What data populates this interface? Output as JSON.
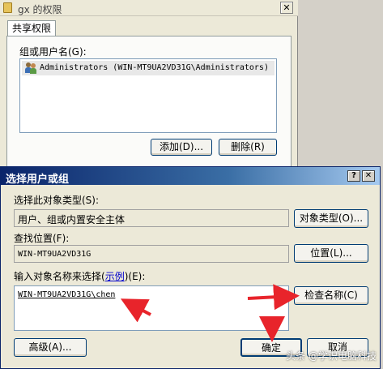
{
  "background_window": {
    "title": "gx 的权限",
    "close_label": "✕",
    "tab_label": "共享权限",
    "group_label": "组或用户名(G):",
    "list_items": [
      "Administrators (WIN-MT9UA2VD31G\\Administrators)"
    ],
    "add_button": "添加(D)...",
    "remove_button": "删除(R)"
  },
  "dialog": {
    "title": "选择用户或组",
    "help_label": "?",
    "close_label": "✕",
    "object_type_label": "选择此对象类型(S):",
    "object_type_value": "用户、组或内置安全主体",
    "object_type_button": "对象类型(O)...",
    "location_label": "查找位置(F):",
    "location_value": "WIN-MT9UA2VD31G",
    "location_button": "位置(L)...",
    "names_label_prefix": "输入对象名称来选择(",
    "names_label_link": "示例",
    "names_label_suffix": ")(E):",
    "names_value": "WIN-MT9UA2VD31G\\chen",
    "check_names_button": "检查名称(C)",
    "advanced_button": "高级(A)...",
    "ok_button": "确定",
    "cancel_button": "取消"
  },
  "watermark": "头条 @学识电脑科技",
  "colors": {
    "title_bar_start": "#0a246a",
    "annotation_arrow": "#e8242b"
  }
}
